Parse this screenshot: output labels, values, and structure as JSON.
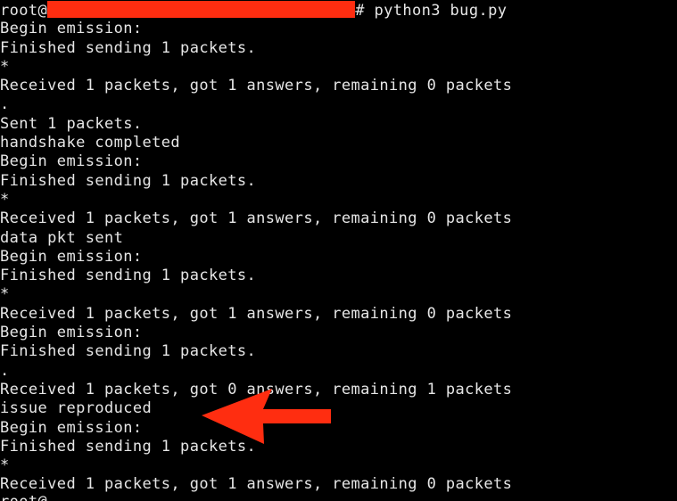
{
  "terminal": {
    "prompt_user": "root@",
    "prompt_symbol": "#",
    "command": "python3 bug.py",
    "lines": [
      "Begin emission:",
      "Finished sending 1 packets.",
      "*",
      "Received 1 packets, got 1 answers, remaining 0 packets",
      ".",
      "Sent 1 packets.",
      "handshake completed",
      "Begin emission:",
      "Finished sending 1 packets.",
      "*",
      "Received 1 packets, got 1 answers, remaining 0 packets",
      "data pkt sent",
      "Begin emission:",
      "Finished sending 1 packets.",
      "*",
      "Received 1 packets, got 1 answers, remaining 0 packets",
      "Begin emission:",
      "Finished sending 1 packets.",
      ".",
      "Received 1 packets, got 0 answers, remaining 1 packets",
      "issue reproduced",
      "Begin emission:",
      "Finished sending 1 packets.",
      "*",
      "Received 1 packets, got 1 answers, remaining 0 packets"
    ],
    "cut_off_line": "root@"
  },
  "colors": {
    "background": "#000000",
    "text": "#e6e6e6",
    "annotation_red": "#ff2d10"
  },
  "icons": {
    "redaction": "red-redaction-bar",
    "annotation": "red-arrow-pointer"
  }
}
